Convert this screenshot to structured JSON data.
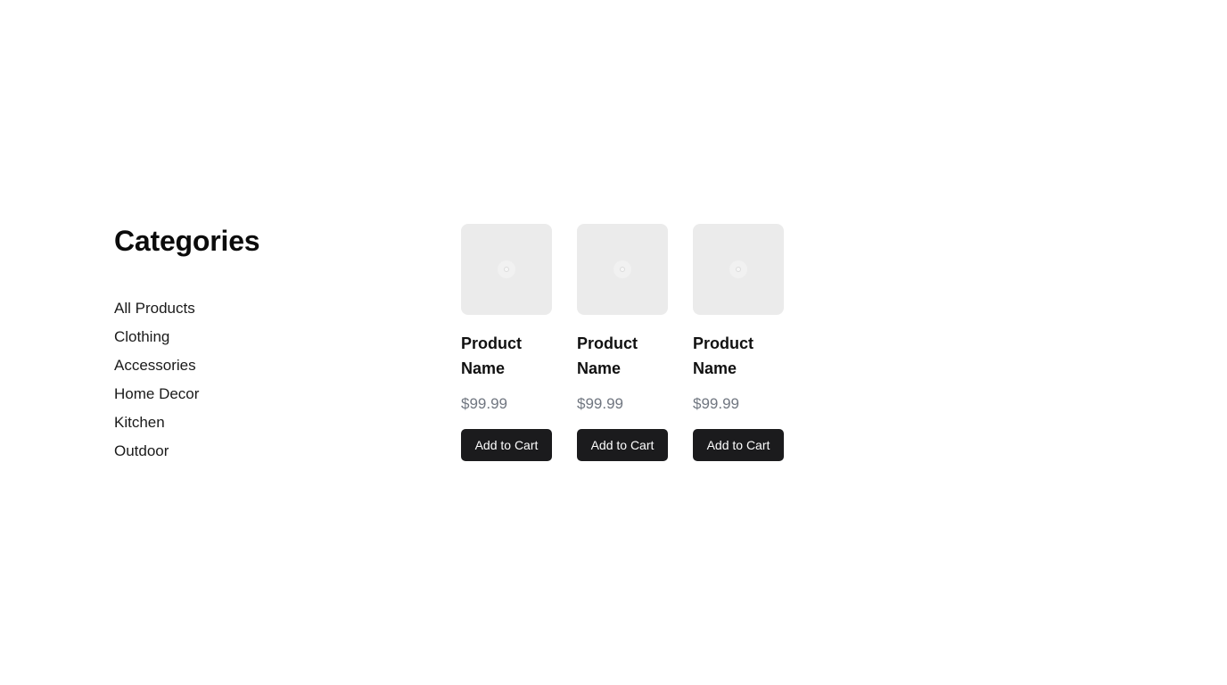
{
  "sidebar": {
    "title": "Categories",
    "items": [
      {
        "label": "All Products"
      },
      {
        "label": "Clothing"
      },
      {
        "label": "Accessories"
      },
      {
        "label": "Home Decor"
      },
      {
        "label": "Kitchen"
      },
      {
        "label": "Outdoor"
      }
    ]
  },
  "products": [
    {
      "name": "Product Name",
      "price": "$99.99",
      "button_label": "Add to Cart",
      "image_icon": "image-placeholder-icon"
    },
    {
      "name": "Product Name",
      "price": "$99.99",
      "button_label": "Add to Cart",
      "image_icon": "image-placeholder-icon"
    },
    {
      "name": "Product Name",
      "price": "$99.99",
      "button_label": "Add to Cart",
      "image_icon": "image-placeholder-icon"
    }
  ],
  "colors": {
    "button_bg": "#1b1b1d",
    "button_text": "#ffffff",
    "price_text": "#707680",
    "thumb_bg": "#ebebeb"
  }
}
